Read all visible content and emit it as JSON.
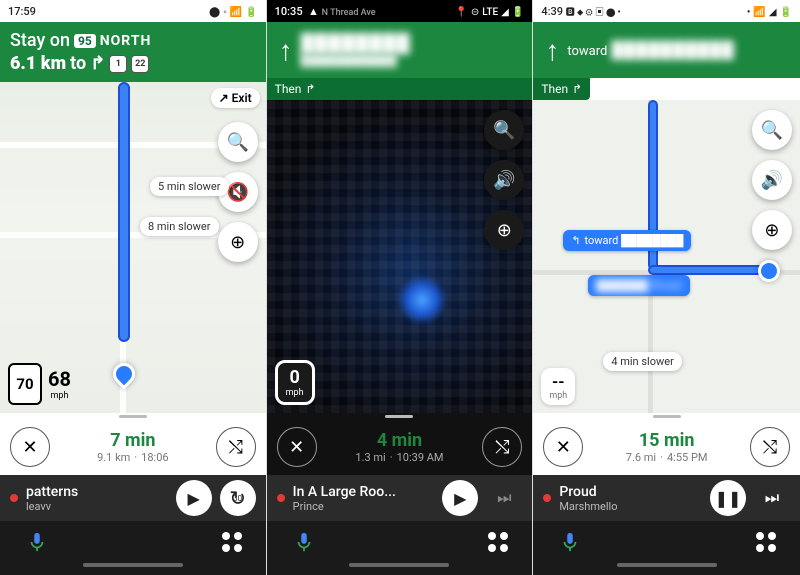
{
  "panels": [
    {
      "status": {
        "time": "17:59",
        "extra": "",
        "theme": "light"
      },
      "banner": {
        "type": "detail",
        "stay_label": "Stay on",
        "highway_shield": "95",
        "direction": "NORTH",
        "distance": "6.1 km",
        "to_label": "to",
        "next_shields": [
          "1",
          "22"
        ]
      },
      "exit_chip": "Exit",
      "altroutes": [
        {
          "text": "5 min slower"
        },
        {
          "text": "8 min slower"
        }
      ],
      "speed": {
        "limit": "70",
        "current": "68",
        "unit": "mph"
      },
      "eta": {
        "time_big": "7 min",
        "dist": "9.1 km",
        "arrive": "18:06"
      },
      "media": {
        "title": "patterns",
        "artist": "leavv",
        "state": "play",
        "secondary": "replay30"
      },
      "fabs": [
        "search",
        "alert",
        "report"
      ],
      "theme": "light"
    },
    {
      "status": {
        "time": "10:35",
        "extra": "LTE",
        "theme": "dark",
        "street": "N Thread Ave"
      },
      "banner": {
        "type": "simple",
        "arrow": "up",
        "dest": "████████",
        "sub": "███████████"
      },
      "then_label": "Then",
      "speed": {
        "current": "0",
        "unit": "mph"
      },
      "eta": {
        "time_big": "4 min",
        "dist": "1.3 mi",
        "arrive": "10:39 AM"
      },
      "media": {
        "title": "In A Large Roo...",
        "artist": "Prince",
        "state": "play",
        "secondary": "next-disabled"
      },
      "fabs": [
        "search",
        "sound",
        "report"
      ],
      "theme": "dark"
    },
    {
      "status": {
        "time": "4:39",
        "extra": "",
        "theme": "light"
      },
      "banner": {
        "type": "simple",
        "arrow": "up",
        "toward_label": "toward",
        "dest": "██████████"
      },
      "then_label": "Then",
      "route_badges": [
        {
          "text": "toward ████████"
        },
        {
          "text": "██████ Road"
        }
      ],
      "altroutes": [
        {
          "text": "4 min slower"
        }
      ],
      "speed": {
        "current": "--",
        "unit": "mph"
      },
      "eta": {
        "time_big": "15 min",
        "dist": "7.6 mi",
        "arrive": "4:55 PM"
      },
      "media": {
        "title": "Proud",
        "artist": "Marshmello",
        "state": "pause",
        "secondary": "next"
      },
      "fabs": [
        "search",
        "sound",
        "report"
      ],
      "theme": "light"
    }
  ],
  "icons": {
    "search": "🔍",
    "alert": "🔇!",
    "report": "💬",
    "sound": "🔊",
    "close": "✕",
    "routes": "⇵",
    "play": "▶",
    "pause": "❚❚",
    "next": "⏭",
    "replay30": "↻30",
    "arrow_up": "↑",
    "then_turn": "↱",
    "turn_left": "↰"
  }
}
